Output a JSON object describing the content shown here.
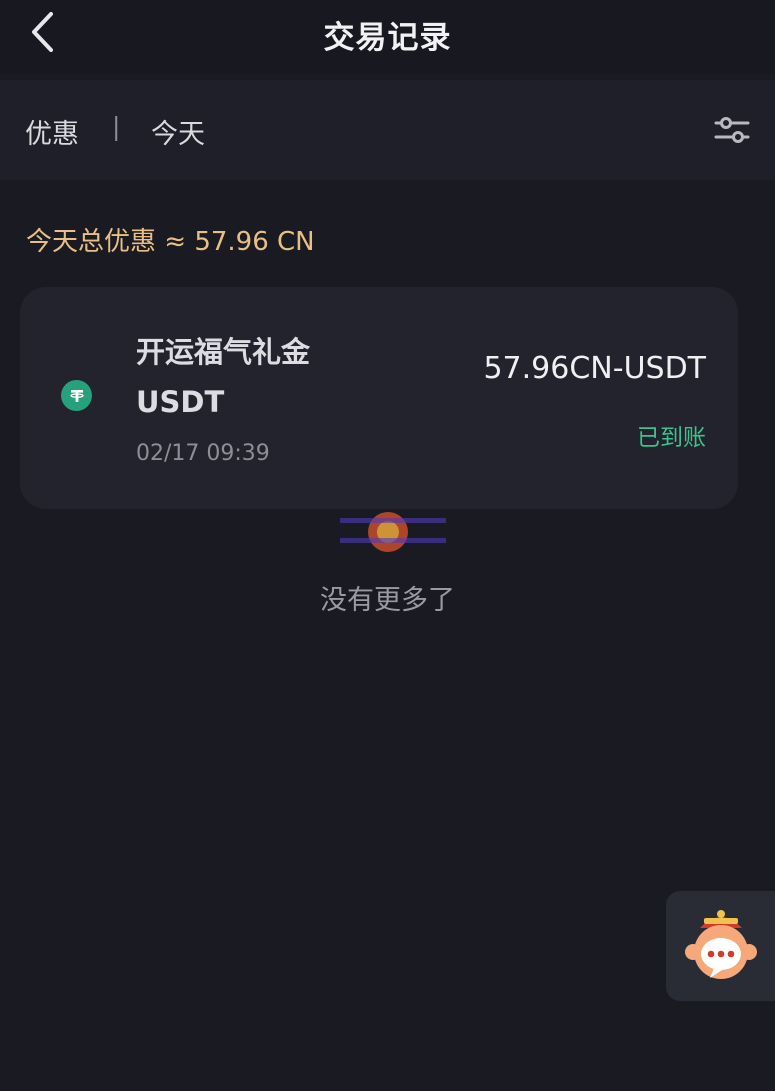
{
  "header": {
    "title": "交易记录",
    "back_icon": "chevron-left-icon"
  },
  "filters": {
    "type": "优惠",
    "separator": "|",
    "date": "今天",
    "filter_icon": "sliders-icon"
  },
  "summary": {
    "text": "今天总优惠 ≈ 57.96 CN"
  },
  "records": [
    {
      "title": "开运福气礼金USDT",
      "date": "02/17 09:39",
      "amount": "57.96CN-USDT",
      "status": "已到账",
      "coin_icon": "usdt-tether-icon"
    }
  ],
  "footer": {
    "no_more": "没有更多了"
  },
  "support": {
    "icon": "customer-service-mascot-icon"
  },
  "colors": {
    "background": "#191a22",
    "card": "#22232c",
    "accent_gold": "#e8bf84",
    "status_green": "#3ec28c",
    "tether_green": "#27a17c"
  }
}
